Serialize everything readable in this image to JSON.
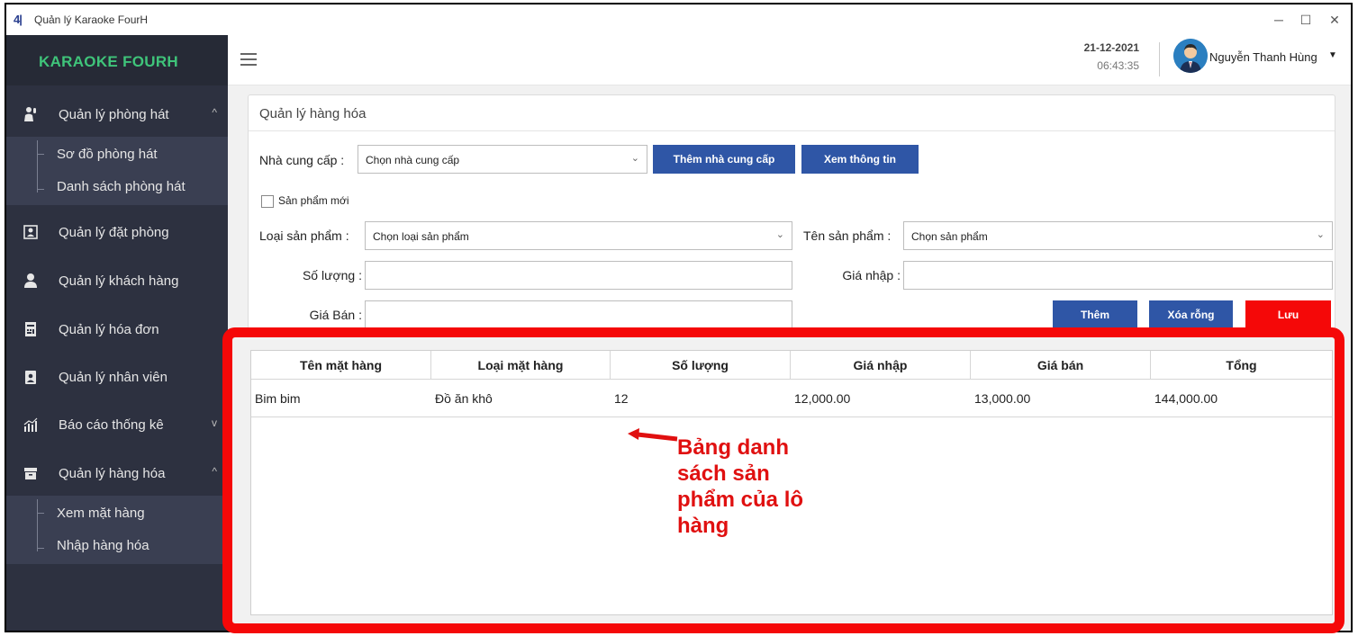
{
  "window": {
    "logo": "4|",
    "title": "Quản lý Karaoke FourH",
    "minimize": "─",
    "maximize": "☐",
    "close": "✕"
  },
  "sidebar": {
    "brand": "KARAOKE FOURH",
    "items": [
      {
        "label": "Quản lý phòng hát",
        "icon": "microphone-singer-icon",
        "caret": "^"
      },
      {
        "label": "Quản lý đặt phòng",
        "icon": "booking-icon"
      },
      {
        "label": "Quản lý khách hàng",
        "icon": "user-icon"
      },
      {
        "label": "Quản lý hóa đơn",
        "icon": "invoice-icon"
      },
      {
        "label": "Quản lý nhân viên",
        "icon": "badge-icon"
      },
      {
        "label": "Báo cáo thống kê",
        "icon": "chart-icon",
        "caret": "v"
      },
      {
        "label": "Quản lý hàng hóa",
        "icon": "box-icon",
        "caret": "^"
      }
    ],
    "sub_room": [
      "Sơ đồ phòng hát",
      "Danh sách phòng hát"
    ],
    "sub_goods": [
      "Xem mặt hàng",
      "Nhập hàng hóa"
    ]
  },
  "header": {
    "date": "21-12-2021",
    "time": "06:43:35",
    "user_name": "Nguyễn Thanh Hùng",
    "user_caret": "▼"
  },
  "panel": {
    "title": "Quản lý hàng hóa",
    "supplier_label": "Nhà cung cấp :",
    "supplier_value": "Chọn nhà cung cấp",
    "add_supplier_button": "Thêm nhà cung cấp",
    "view_info_button": "Xem thông tin",
    "new_product_label": "Sản phẩm mới",
    "product_type_label": "Loại sản phẩm :",
    "product_type_value": "Chọn loại sản phẩm",
    "product_name_label": "Tên sản phẩm :",
    "product_name_value": "Chọn sản phẩm",
    "quantity_label": "Số lượng :",
    "import_price_label": "Giá nhập :",
    "sale_price_label": "Giá Bán :",
    "add_button": "Thêm",
    "clear_button": "Xóa rỗng",
    "save_button": "Lưu"
  },
  "table": {
    "columns": [
      "Tên mặt hàng",
      "Loại mặt hàng",
      "Số lượng",
      "Giá nhập",
      "Giá bán",
      "Tổng"
    ],
    "rows": [
      [
        "Bim bim",
        "Đồ ăn khô",
        "12",
        "12,000.00",
        "13,000.00",
        "144,000.00"
      ]
    ]
  },
  "annotation": {
    "line1": "Bảng danh",
    "line2": "sách sản",
    "line3": "phẩm của lô",
    "line4": "hàng",
    "color": "#e01010"
  },
  "colors": {
    "sidebar_bg": "#2d3140",
    "brand_text": "#3fc47a",
    "button_blue": "#2f56a6",
    "button_red": "#f50808"
  }
}
